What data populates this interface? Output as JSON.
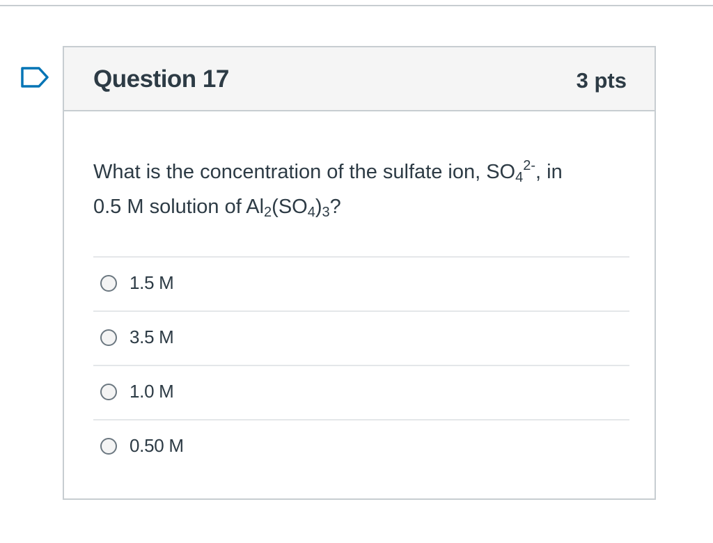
{
  "question": {
    "title": "Question 17",
    "points": "3 pts",
    "text": {
      "part1": "What is the concentration of the sulfate ion, SO",
      "sub1": "4",
      "sup1": "2-",
      "part2": ", in",
      "part3": "0.5 M solution of Al",
      "sub2": "2",
      "part4": "(SO",
      "sub3": "4",
      "part5": ")",
      "sub4": "3",
      "part6": "?"
    }
  },
  "answers": [
    {
      "label": "1.5 M",
      "selected": false
    },
    {
      "label": "3.5 M",
      "selected": false
    },
    {
      "label": "1.0 M",
      "selected": false
    },
    {
      "label": "0.50 M",
      "selected": false
    }
  ],
  "icons": {
    "flag": "bookmark-flag-icon"
  },
  "colors": {
    "text": "#2d3b45",
    "border": "#c7cdd1",
    "header_bg": "#f5f5f5",
    "flag": "#0374b5"
  }
}
